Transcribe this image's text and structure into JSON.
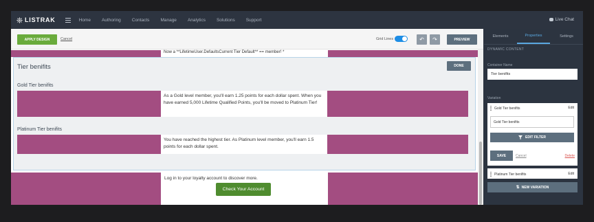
{
  "nav": {
    "logo": "LISTRAK",
    "links": [
      "Home",
      "Authoring",
      "Contacts",
      "Manage",
      "Analytics",
      "Solutions",
      "Support"
    ],
    "live_chat": "Live Chat"
  },
  "toolbar": {
    "apply_label": "APPLY DESIGN",
    "cancel_label": "Cancel",
    "gridlines_label": "Grid Lines",
    "gridlines_on": true,
    "preview_label": "PREVIEW"
  },
  "canvas": {
    "top_cut_text": "Now a **LifetimeUser.DefaultsCurrent Tier Default** == member! *",
    "panel": {
      "title": "Tier benifits",
      "done_label": "DONE",
      "tiers": [
        {
          "label": "Gold Tier benifits",
          "text": "As a Gold level member, you'll earn 1.25 points for each dollar spent. When you have earned 5,000 Lifetime Qualified Points, you'll be moved to Platinum Tier!"
        },
        {
          "label": "Platinum Tier benifits",
          "text": "You have reached the highest tier. As Platinum level member, you'll earn 1.5 points for each dollar spent."
        }
      ]
    },
    "login_text": "Log in to your loyalty account to discover more.",
    "check_button": "Check Your Account",
    "colors": {
      "magenta": "#a34d81",
      "panel": "#eef0f2",
      "button_green": "#4f8c2f"
    }
  },
  "sidebar": {
    "tabs": [
      "Elements",
      "Properties",
      "Settings"
    ],
    "active_tab": "Properties",
    "section_title": "DYNAMIC CONTENT",
    "container_name_label": "Container Name",
    "container_name_value": "Tier benifits",
    "variation_label": "Variation",
    "variations": [
      {
        "name": "Gold Tier benifits",
        "edit": "Edit"
      },
      {
        "name": "Platinum Tier benifits",
        "edit": "Edit"
      }
    ],
    "variation_input_value": "Gold Tier benifits",
    "edit_filter_label": "EDIT FILTER",
    "save_label": "SAVE",
    "cancel_label": "Cancel",
    "delete_label": "Delete",
    "new_variation_label": "NEW VARIATION"
  }
}
